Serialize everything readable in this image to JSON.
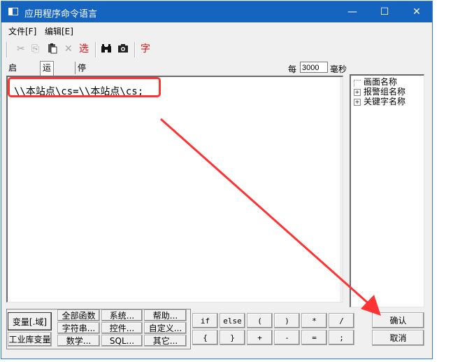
{
  "window": {
    "title": "应用程序命令语言",
    "minimize": "—",
    "maximize": "☐",
    "close": "✕"
  },
  "menu": [
    "文件[F]",
    "编辑[E]"
  ],
  "toolbar": {
    "cut_icon": "✂",
    "copy_icon": "⎘",
    "paste_icon": "📋",
    "delete_icon": "✕",
    "select_label": "选",
    "find_icon": "binoculars-icon",
    "camera_icon": "camera-icon",
    "font_label": "字"
  },
  "tabs": [
    "启动时",
    "运行时",
    "停止时"
  ],
  "interval": {
    "label": "每",
    "value": "3000",
    "unit": "毫秒"
  },
  "editor": {
    "code": "\\\\本站点\\cs=\\\\本站点\\cs;"
  },
  "tree": {
    "items": [
      "画面名称",
      "报警组名称",
      "关键字名称"
    ]
  },
  "buttons": {
    "var_domain": "变量[.域]",
    "industrial_var": "工业库变量",
    "all_functions": "全部函数",
    "system": "系统...",
    "help": "帮助...",
    "string": "字符串...",
    "control": "控件...",
    "custom": "自定义...",
    "math": "数学...",
    "sql": "SQL...",
    "other": "其它...",
    "ops_row1": [
      "if",
      "else",
      "(",
      ")",
      "*",
      "/"
    ],
    "ops_row2": [
      "{",
      "}",
      "+",
      "-",
      "=",
      ";"
    ],
    "ok": "确认",
    "cancel": "取消"
  },
  "colors": {
    "titlebar": "#1565c0",
    "annotation": "#ff3333"
  }
}
